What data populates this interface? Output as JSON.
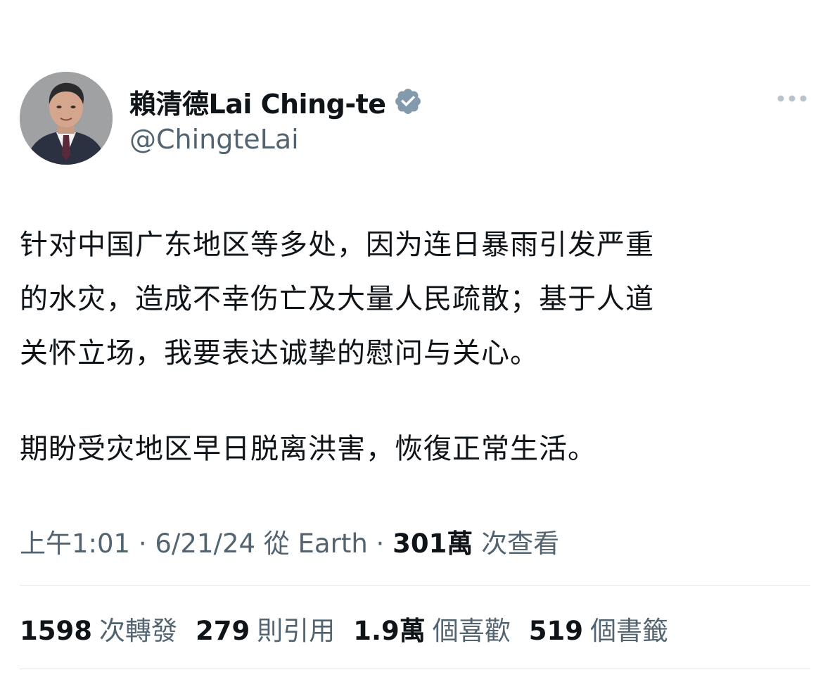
{
  "author": {
    "display_name": "賴清德Lai Ching-te",
    "handle": "@ChingteLai",
    "verified": true,
    "verified_color": "#829aab",
    "avatar": "profile-photo"
  },
  "tweet": {
    "paragraphs": [
      [
        "针对中国广东地区等多处，因为连日暴雨引发严重",
        "的水灾，造成不幸伤亡及大量人民疏散；基于人道",
        "关怀立场，我要表达诚挚的慰问与关心。"
      ],
      [
        "期盼受灾地区早日脱离洪害，恢復正常生活。"
      ]
    ]
  },
  "meta": {
    "time": "上午1:01",
    "separator": " · ",
    "date": "6/21/24",
    "source": "從 Earth",
    "views_count": "301萬",
    "views_label": " 次查看"
  },
  "stats": [
    {
      "count": "1598",
      "label": "次轉發"
    },
    {
      "count": "279",
      "label": "則引用"
    },
    {
      "count": "1.9萬",
      "label": "個喜歡"
    },
    {
      "count": "519",
      "label": "個書籤"
    }
  ],
  "colors": {
    "text_primary": "#0f1419",
    "text_secondary": "#536471",
    "divider": "#e1e5e8"
  }
}
